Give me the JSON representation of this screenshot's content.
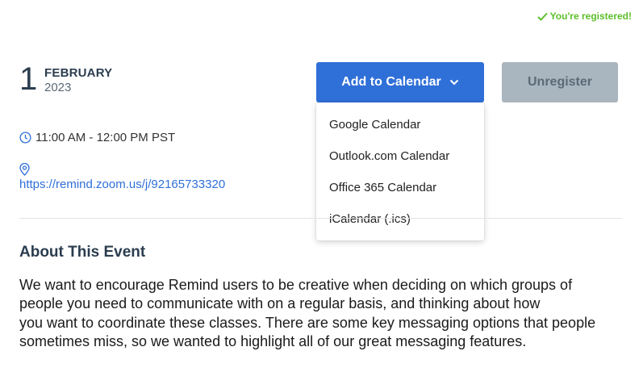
{
  "status": {
    "registered_text": "You're registered!"
  },
  "event": {
    "day": "1",
    "month": "FEBRUARY",
    "year": "2023",
    "time": "11:00 AM - 12:00 PM PST",
    "location_url": "https://remind.zoom.us/j/92165733320"
  },
  "actions": {
    "add_to_calendar_label": "Add to Calendar",
    "unregister_label": "Unregister"
  },
  "calendar_menu": {
    "items": [
      {
        "label": "Google Calendar"
      },
      {
        "label": "Outlook.com Calendar"
      },
      {
        "label": "Office 365 Calendar"
      },
      {
        "label": "iCalendar (.ics)"
      }
    ]
  },
  "about": {
    "title": "About This Event",
    "lines": [
      "We want to encourage Remind users to be creative when deciding on which groups of",
      "people you need to communicate with on a regular basis, and thinking about how",
      "you want to coordinate these classes. There are some key messaging options that people",
      "sometimes miss, so we wanted to highlight all of our great messaging features."
    ]
  },
  "colors": {
    "primary": "#2f6fd8",
    "success": "#5cbf2a",
    "disabled": "#a9b5bf",
    "heading": "#2b3d4f"
  },
  "icons": [
    "check-icon",
    "chevron-down-icon",
    "clock-icon",
    "location-pin-icon"
  ]
}
